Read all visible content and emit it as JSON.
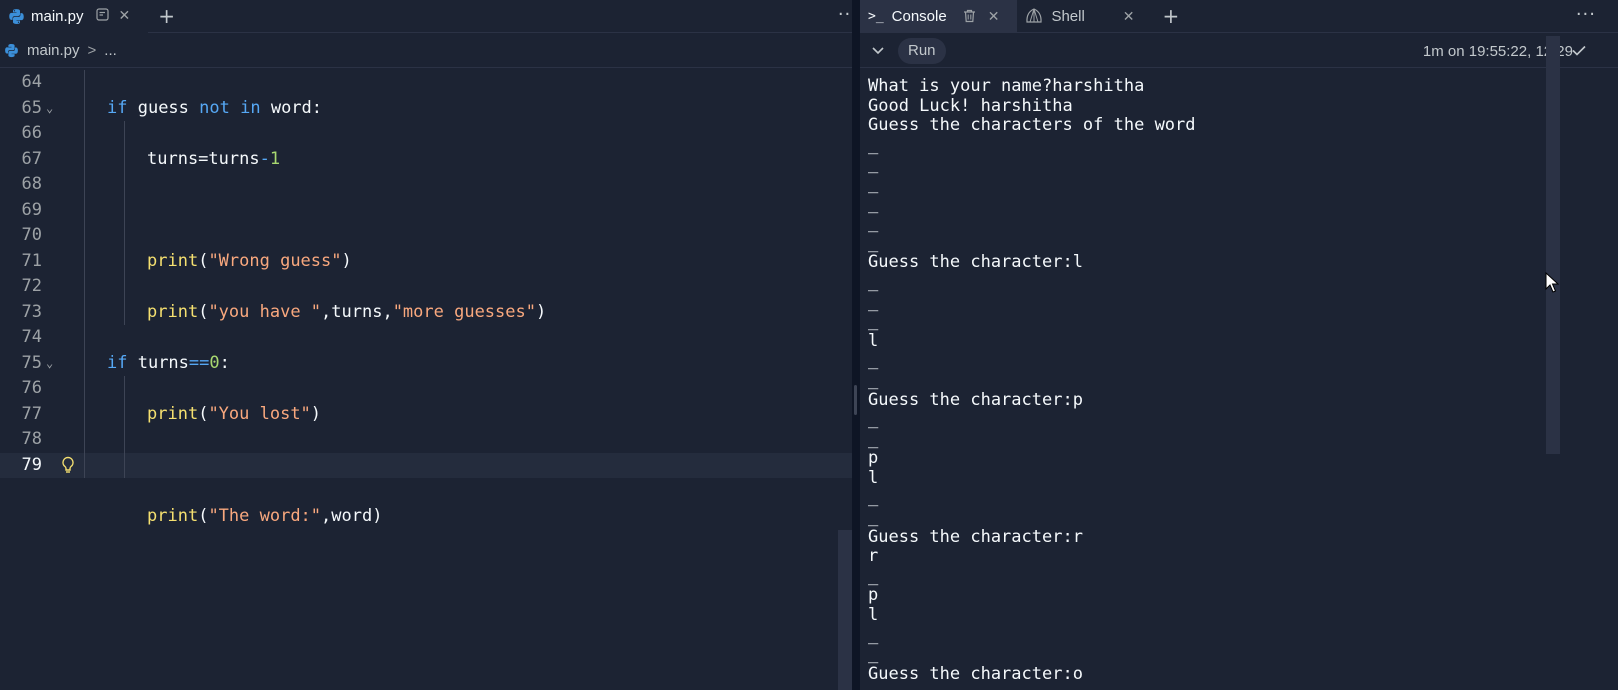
{
  "editor": {
    "tab_label": "main.py",
    "breadcrumb_file": "main.py",
    "breadcrumb_sep": ">",
    "breadcrumb_more": "...",
    "lines": [
      {
        "num": "64"
      },
      {
        "num": "65"
      },
      {
        "num": "66"
      },
      {
        "num": "67"
      },
      {
        "num": "68"
      },
      {
        "num": "69"
      },
      {
        "num": "70"
      },
      {
        "num": "71"
      },
      {
        "num": "72"
      },
      {
        "num": "73"
      },
      {
        "num": "74"
      },
      {
        "num": "75"
      },
      {
        "num": "76"
      },
      {
        "num": "77"
      },
      {
        "num": "78"
      },
      {
        "num": "79"
      }
    ],
    "code": {
      "l65": {
        "kw1": "if",
        "a": " guess ",
        "kw2": "not",
        "b": " ",
        "kw3": "in",
        "c": " word:"
      },
      "l67": {
        "a": "turns=turns",
        "op": "-",
        "num": "1"
      },
      "l71": {
        "fn": "print",
        "a": "(",
        "str": "\"Wrong guess\"",
        "b": ")"
      },
      "l73": {
        "fn": "print",
        "a": "(",
        "str1": "\"you have \"",
        "b": ",turns,",
        "str2": "\"more guesses\"",
        "c": ")"
      },
      "l75": {
        "kw": "if",
        "a": " turns",
        "op": "==",
        "num": "0",
        "b": ":"
      },
      "l77": {
        "fn": "print",
        "a": "(",
        "str": "\"You lost\"",
        "b": ")"
      },
      "l79": {
        "fn": "print",
        "a": "(",
        "str": "\"The word:\"",
        "b": ",word)"
      }
    }
  },
  "console": {
    "tab_console": "Console",
    "tab_shell": "Shell",
    "run_label": "Run",
    "status": "1m on 19:55:22, 12/29",
    "output": [
      "What is your name?harshitha",
      "Good Luck! harshitha",
      "Guess the characters of the word",
      "_",
      "_",
      "_",
      "_",
      "_",
      "_",
      "Guess the character:l",
      "_",
      "_",
      "_",
      "l",
      "_",
      "_",
      "Guess the character:p",
      "_",
      "_",
      "p",
      "l",
      "_",
      "_",
      "Guess the character:r",
      "r",
      "_",
      "p",
      "l",
      "_",
      "_",
      "Guess the character:o"
    ]
  }
}
